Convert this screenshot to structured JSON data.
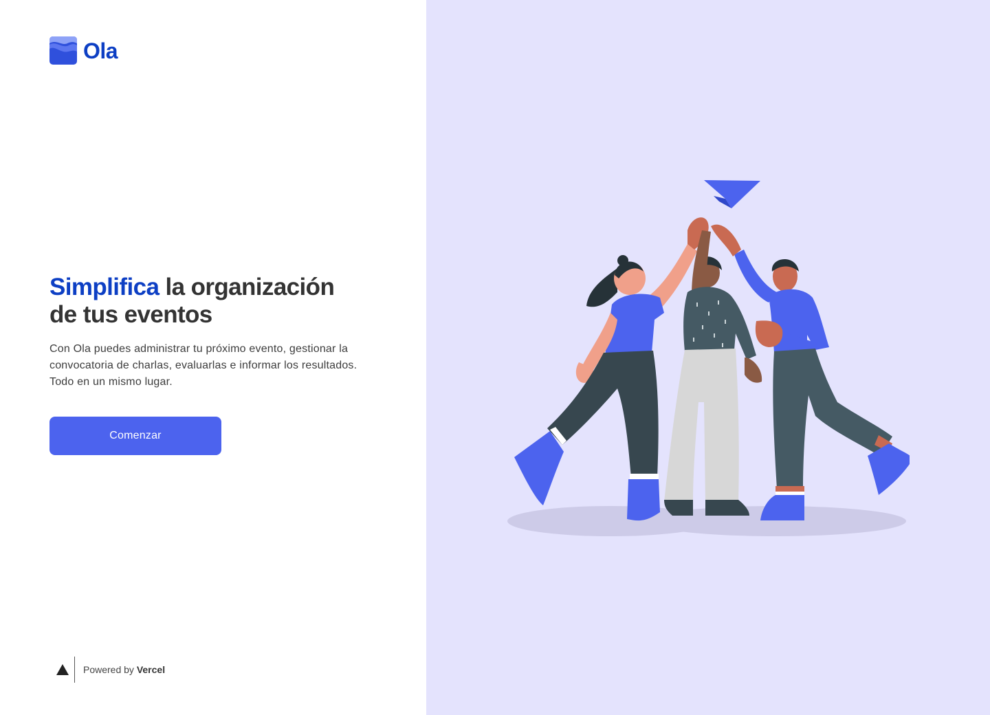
{
  "brand": {
    "name": "Ola"
  },
  "hero": {
    "headline_accent": "Simplifica",
    "headline_rest": " la organización",
    "headline_line2": "de tus eventos",
    "description_lines": [
      "Con Ola puedes administrar tu próximo evento, gestionar la",
      "convocatoria de charlas, evaluarlas e informar los resultados.",
      "Todo en un mismo lugar."
    ],
    "cta_label": "Comenzar"
  },
  "footer": {
    "powered_prefix": "Powered by",
    "powered_brand": "Vercel"
  },
  "icons": {
    "logo": "ola-logo-icon",
    "vercel": "vercel-triangle-icon",
    "paper_plane": "paper-plane-icon"
  },
  "colors": {
    "brand_blue": "#0d3fc4",
    "button_blue": "#4c63ee",
    "panel_lavender": "#e4e3fd",
    "text_dark": "#333333"
  }
}
